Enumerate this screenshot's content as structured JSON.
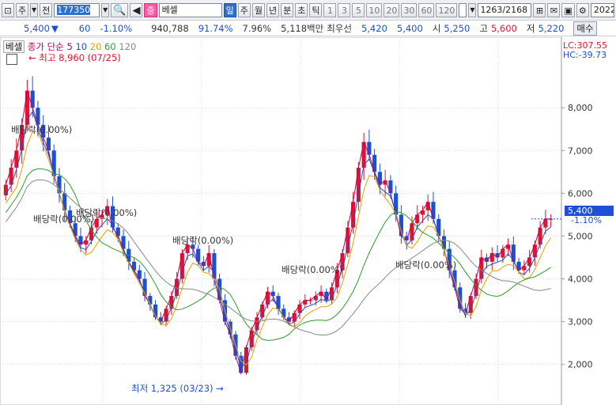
{
  "toolbar": {
    "market": "주",
    "period": "전",
    "code": "177350",
    "stock_name": "베셀",
    "kind": "증",
    "tabs": [
      "일",
      "주",
      "월",
      "년",
      "분",
      "초",
      "틱"
    ],
    "active_tab": "일",
    "numbers": [
      "1",
      "3",
      "5",
      "10",
      "20",
      "30",
      "60",
      "120"
    ],
    "count": "1263",
    "total": "/2168",
    "date_stub": "2022"
  },
  "quote": {
    "price": "5,400",
    "change": "60",
    "change_pct": "-1.10%",
    "volume": "940,788",
    "turnover_pct": "91.74%",
    "vol_pct": "7.96%",
    "amount": "5,118백만",
    "best_label": "최우선",
    "best_ask": "5,420",
    "best_bid": "5,400",
    "open_label": "시",
    "open": "5,250",
    "high_label": "고",
    "high": "5,600",
    "low_label": "저",
    "low": "5,220",
    "sell_label": "매수"
  },
  "legend": {
    "name": "베셀",
    "ma_label": "종가 단순",
    "periods": [
      {
        "text": "5",
        "color": "#c00066"
      },
      {
        "text": "10",
        "color": "#1d4fd1"
      },
      {
        "text": "20",
        "color": "#e6a000"
      },
      {
        "text": "60",
        "color": "#2e9a2e"
      },
      {
        "text": "120",
        "color": "#888888"
      }
    ]
  },
  "chart_data": {
    "type": "candlestick",
    "y_ticks": [
      "8,000",
      "7,000",
      "6,000",
      "5,000",
      "4,000",
      "3,000",
      "2,000"
    ],
    "ylim": [
      1050,
      9650
    ],
    "current_price": "5,400",
    "current_pct": "-1.10%",
    "lc": "LC:307.55",
    "hc": "HC:-39.73",
    "high_label": "최고 8,960 (07/25)",
    "low_label": "최저 1,325 (03/23)",
    "dividend_label": "배당락(0.00%)",
    "closes": [
      6200,
      6600,
      7000,
      7600,
      8400,
      8000,
      7600,
      7300,
      7000,
      6400,
      6000,
      5600,
      5300,
      5000,
      4800,
      4900,
      5200,
      5400,
      5500,
      5700,
      5200,
      5000,
      4700,
      4400,
      4200,
      4000,
      3600,
      3400,
      3100,
      3000,
      3300,
      3600,
      4000,
      4600,
      4800,
      4700,
      4400,
      4300,
      4600,
      4000,
      3500,
      3000,
      2700,
      2200,
      1800,
      2400,
      2800,
      3100,
      3400,
      3700,
      3600,
      3300,
      3100,
      3000,
      3200,
      3400,
      3500,
      3500,
      3600,
      3700,
      3500,
      3800,
      4200,
      4600,
      5200,
      5800,
      6600,
      7200,
      6900,
      6500,
      6200,
      6300,
      6000,
      5500,
      5000,
      4900,
      5300,
      5500,
      5600,
      5800,
      5400,
      5000,
      4700,
      4200,
      3800,
      3300,
      3200,
      3600,
      4000,
      4500,
      4400,
      4600,
      4500,
      4700,
      4800,
      4400,
      4200,
      4300,
      4500,
      4800,
      5200,
      5400,
      5400
    ],
    "ma_colors": [
      "#c00066",
      "#1d4fd1",
      "#e6a000",
      "#2e9a2e",
      "#888888"
    ]
  }
}
